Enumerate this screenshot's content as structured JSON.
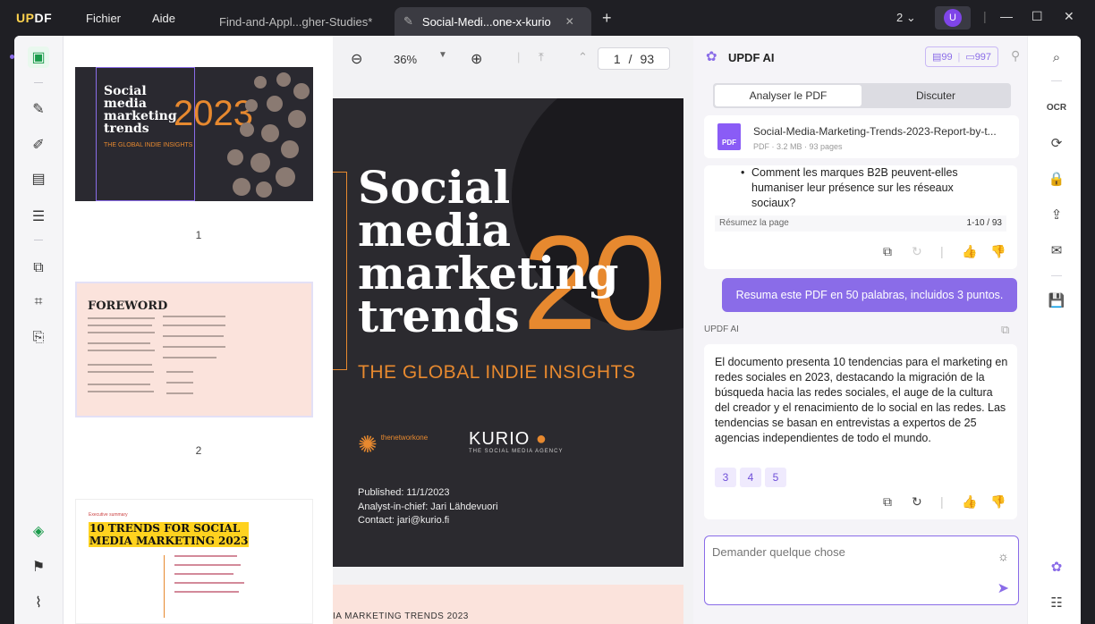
{
  "titlebar": {
    "logo_u": "UP",
    "logo_rest": "DF",
    "menu_file": "Fichier",
    "menu_help": "Aide",
    "tabs": [
      {
        "label": "Find-and-Appl...gher-Studies*"
      },
      {
        "label": "Social-Medi...one-x-kurio"
      }
    ],
    "add_tab": "+",
    "window_count": "2",
    "avatar": "U"
  },
  "viewer": {
    "zoom": "36%",
    "page_current": "1",
    "page_sep": "/",
    "page_total": "93",
    "cover": {
      "title_line1": "Social",
      "title_line2": "media",
      "title_line3": "marketing",
      "title_line4": "trends",
      "year": "20",
      "insights": "THE GLOBAL INDIE INSIGHTS",
      "logo_network": "thenetworkone",
      "logo_kurio": "KURIO",
      "logo_kurio_sub": "THE SOCIAL MEDIA AGENCY",
      "published": "Published: 11/1/2023",
      "analyst": "Analyst-in-chief: Jari Lähdevuori",
      "contact": "Contact: jari@kurio.fi"
    },
    "next_page_header": "IA MARKETING TRENDS 2023"
  },
  "thumbnails": {
    "page1": {
      "title_l1": "Social",
      "title_l2": "media",
      "title_l3": "marketing",
      "title_l4": "trends",
      "year": "2023",
      "sub": "THE GLOBAL INDIE INSIGHTS",
      "num": "1"
    },
    "page2": {
      "heading": "FOREWORD",
      "num": "2"
    },
    "page3": {
      "label": "Executive summary",
      "heading_l1": "10 TRENDS FOR SOCIAL",
      "heading_l2": "MEDIA MARKETING 2023"
    }
  },
  "ai": {
    "title": "UPDF AI",
    "quota_a": "99",
    "quota_b": "997",
    "tab_analyze": "Analyser le PDF",
    "tab_chat": "Discuter",
    "file_name": "Social-Media-Marketing-Trends-2023-Report-by-t...",
    "file_info": "PDF · 3.2 MB · 93 pages",
    "file_badge": "PDF",
    "prev_bullet": "Comment les marques B2B peuvent-elles humaniser leur présence sur les réseaux sociaux?",
    "summary_label": "Résumez la page",
    "summary_range": "1-10 / 93",
    "user_message": "Resuma este PDF en 50 palabras, incluidos 3 puntos.",
    "ai_label": "UPDF AI",
    "answer": "El documento presenta 10 tendencias para el marketing en redes sociales en 2023, destacando la migración de la búsqueda hacia las redes sociales, el auge de la cultura del creador y el renacimiento de lo social en las redes. Las tendencias se basan en entrevistas a expertos de 25 agencias independientes de todo el mundo.",
    "refs": [
      "3",
      "4",
      "5"
    ],
    "ask_placeholder": "Demander quelque chose"
  }
}
